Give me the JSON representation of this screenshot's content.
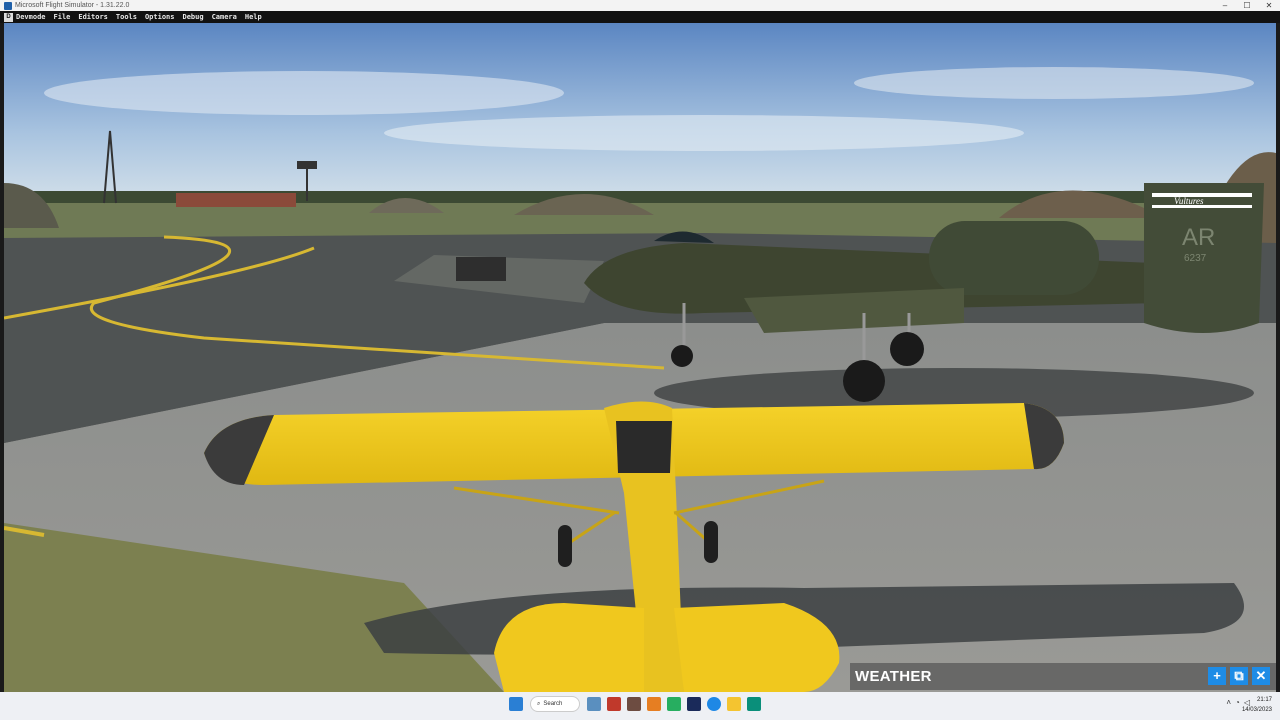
{
  "window": {
    "title": "Microsoft Flight Simulator - 1.31.22.0"
  },
  "menu": {
    "items": [
      "Devmode",
      "File",
      "Editors",
      "Tools",
      "Options",
      "Debug",
      "Camera",
      "Help"
    ]
  },
  "scene": {
    "tail_code": "AR",
    "tail_number": "6237",
    "tail_stripe_text": "Vultures"
  },
  "weather_panel": {
    "title": "WEATHER",
    "add_symbol": "+",
    "popout_symbol": "⧉",
    "close_symbol": "✕"
  },
  "taskbar": {
    "search_label": "Search",
    "time": "21:17",
    "date": "14/03/2023"
  }
}
